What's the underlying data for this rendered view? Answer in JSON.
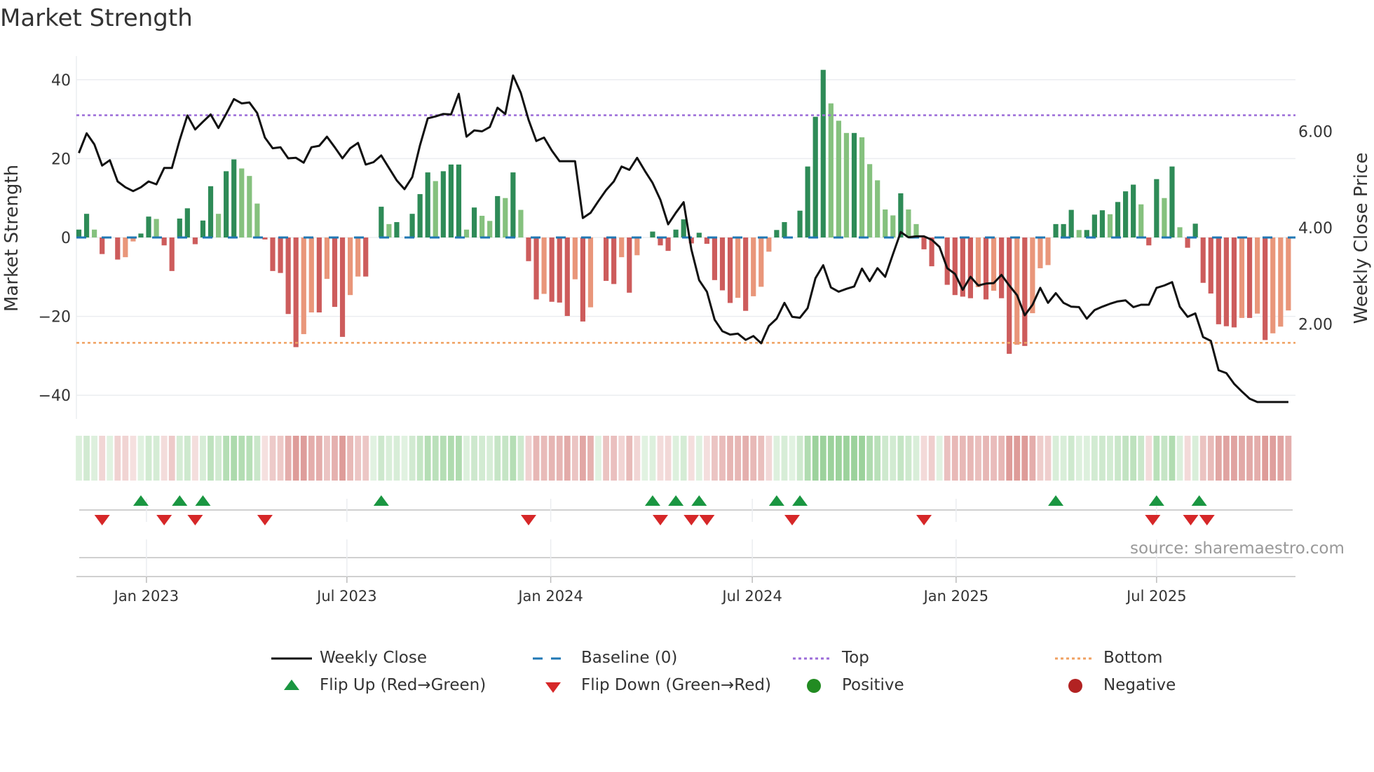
{
  "title": "Market Strength",
  "source": "source: sharemaestro.com",
  "legend": {
    "weekly_close": "Weekly Close",
    "baseline": "Baseline (0)",
    "top": "Top",
    "bottom": "Bottom",
    "flip_up": "Flip Up (Red→Green)",
    "flip_down": "Flip Down (Green→Red)",
    "positive": "Positive",
    "negative": "Negative"
  },
  "colors": {
    "up_strong": "#2e8b57",
    "up_weak": "#85c17e",
    "down_strong": "#cd5c5c",
    "down_weak": "#e9967a",
    "line": "#111111",
    "top": "#9b6bd8",
    "bottom": "#f0a060",
    "baseline": "#1f77b4",
    "flip_up": "#1a9641",
    "flip_down": "#d62728",
    "positive": "#228b22",
    "negative": "#b22222"
  },
  "chart_data": {
    "type": "bar",
    "title": "Market Strength",
    "ylabel": "Market Strength",
    "y2label": "Weekly Close Price",
    "ylim": [
      -46,
      46
    ],
    "y2lim": [
      0.15,
      7.4
    ],
    "yticks": [
      40,
      20,
      0,
      -20,
      -40
    ],
    "yticklabels": [
      "40",
      "20",
      "0",
      "−20",
      "−40"
    ],
    "y2ticks": [
      6,
      4,
      2
    ],
    "y2ticklabels": [
      "6.00",
      "4.00",
      "2.00"
    ],
    "start_week": "2022-11-01",
    "interval_days": 7,
    "xticks": [
      {
        "date": "2023-01-01",
        "label": "Jan 2023"
      },
      {
        "date": "2023-07-01",
        "label": "Jul 2023"
      },
      {
        "date": "2024-01-01",
        "label": "Jan 2024"
      },
      {
        "date": "2024-07-01",
        "label": "Jul 2024"
      },
      {
        "date": "2025-01-01",
        "label": "Jan 2025"
      },
      {
        "date": "2025-07-01",
        "label": "Jul 2025"
      }
    ],
    "top_level": 31,
    "bottom_level": -26.7,
    "baseline": 0,
    "strength": [
      2,
      6,
      2,
      -4.2,
      0,
      -5.6,
      -5,
      -1,
      1,
      5.3,
      4.7,
      -2,
      -8.5,
      4.8,
      7.4,
      -1.7,
      4.3,
      13,
      6,
      16.8,
      19.8,
      17.5,
      15.6,
      8.6,
      -0.5,
      -8.5,
      -9,
      -19.4,
      -27.8,
      -24.5,
      -19,
      -19,
      -10.5,
      -17.6,
      -25.2,
      -14.6,
      -9.9,
      -9.9,
      0,
      7.8,
      3.4,
      3.9,
      0,
      6,
      11,
      16.5,
      14.3,
      16.8,
      18.5,
      18.5,
      2,
      7.6,
      5.5,
      4.2,
      10.5,
      10,
      16.5,
      7,
      -6,
      -15.7,
      -14.3,
      -16.3,
      -16.5,
      -19.9,
      -10.6,
      -21.3,
      -17.7,
      0,
      -11,
      -11.8,
      -5,
      -14,
      -4.5,
      0,
      1.5,
      -2,
      -3.4,
      2,
      4.6,
      -1.5,
      1.2,
      -1.6,
      -10.8,
      -13.4,
      -16.6,
      -15.3,
      -18.6,
      -14.9,
      -12.5,
      -3.6,
      1.9,
      3.9,
      0,
      6.8,
      18,
      30.6,
      42.5,
      34,
      29.6,
      26.5,
      26.5,
      25.4,
      18.6,
      14.5,
      7.1,
      5.6,
      11.2,
      7.1,
      3.4,
      -3,
      -7.3,
      0,
      -12,
      -14.6,
      -15,
      -15.4,
      -12.6,
      -15.7,
      -13.5,
      -15.4,
      -29.5,
      -27.2,
      -27.5,
      -19.2,
      -7.8,
      -7,
      3.4,
      3.4,
      7,
      1.9,
      1.9,
      5.8,
      6.9,
      5.9,
      9,
      11.7,
      13.4,
      8.4,
      -2,
      14.8,
      10,
      18,
      2.6,
      -2.6,
      3.5,
      -11.5,
      -14.2,
      -22,
      -22.5,
      -22.8,
      -20.4,
      -20.4,
      -19.3,
      -26,
      -24.3,
      -22.6,
      -18.5
    ],
    "weekly_close": [
      5.55,
      5.96,
      5.73,
      5.29,
      5.4,
      4.96,
      4.84,
      4.76,
      4.84,
      4.96,
      4.9,
      5.24,
      5.24,
      5.82,
      6.33,
      6.04,
      6.2,
      6.35,
      6.07,
      6.36,
      6.67,
      6.58,
      6.6,
      6.38,
      5.87,
      5.65,
      5.67,
      5.44,
      5.45,
      5.35,
      5.67,
      5.7,
      5.89,
      5.67,
      5.44,
      5.65,
      5.76,
      5.31,
      5.36,
      5.5,
      5.24,
      4.98,
      4.8,
      5.05,
      5.71,
      6.27,
      6.31,
      6.36,
      6.35,
      6.78,
      5.89,
      6.02,
      6.0,
      6.09,
      6.49,
      6.36,
      7.16,
      6.8,
      6.24,
      5.8,
      5.87,
      5.6,
      5.38,
      5.38,
      5.38,
      4.2,
      4.31,
      4.55,
      4.78,
      4.96,
      5.27,
      5.2,
      5.45,
      5.18,
      4.93,
      4.58,
      4.07,
      4.31,
      4.53,
      3.55,
      2.91,
      2.67,
      2.09,
      1.85,
      1.78,
      1.8,
      1.67,
      1.75,
      1.6,
      1.96,
      2.11,
      2.44,
      2.15,
      2.13,
      2.33,
      2.95,
      3.22,
      2.76,
      2.67,
      2.73,
      2.78,
      3.15,
      2.89,
      3.16,
      2.98,
      3.45,
      3.91,
      3.8,
      3.82,
      3.82,
      3.75,
      3.6,
      3.16,
      3.04,
      2.71,
      2.98,
      2.8,
      2.84,
      2.85,
      3.02,
      2.8,
      2.6,
      2.18,
      2.4,
      2.75,
      2.44,
      2.64,
      2.44,
      2.36,
      2.35,
      2.11,
      2.29,
      2.36,
      2.42,
      2.47,
      2.49,
      2.35,
      2.4,
      2.4,
      2.75,
      2.8,
      2.87,
      2.36,
      2.15,
      2.22,
      1.73,
      1.65,
      1.04,
      0.98,
      0.76,
      0.6,
      0.45,
      0.38,
      0.38,
      0.38,
      0.38,
      0.38
    ],
    "flip_up_weeks": [
      8,
      13,
      16,
      39,
      74,
      77,
      80,
      90,
      93,
      126,
      139,
      144.5
    ],
    "flip_down_weeks": [
      3,
      11,
      15,
      24,
      58,
      75,
      79,
      81,
      92,
      109,
      138.5,
      143.4,
      145.5
    ]
  }
}
